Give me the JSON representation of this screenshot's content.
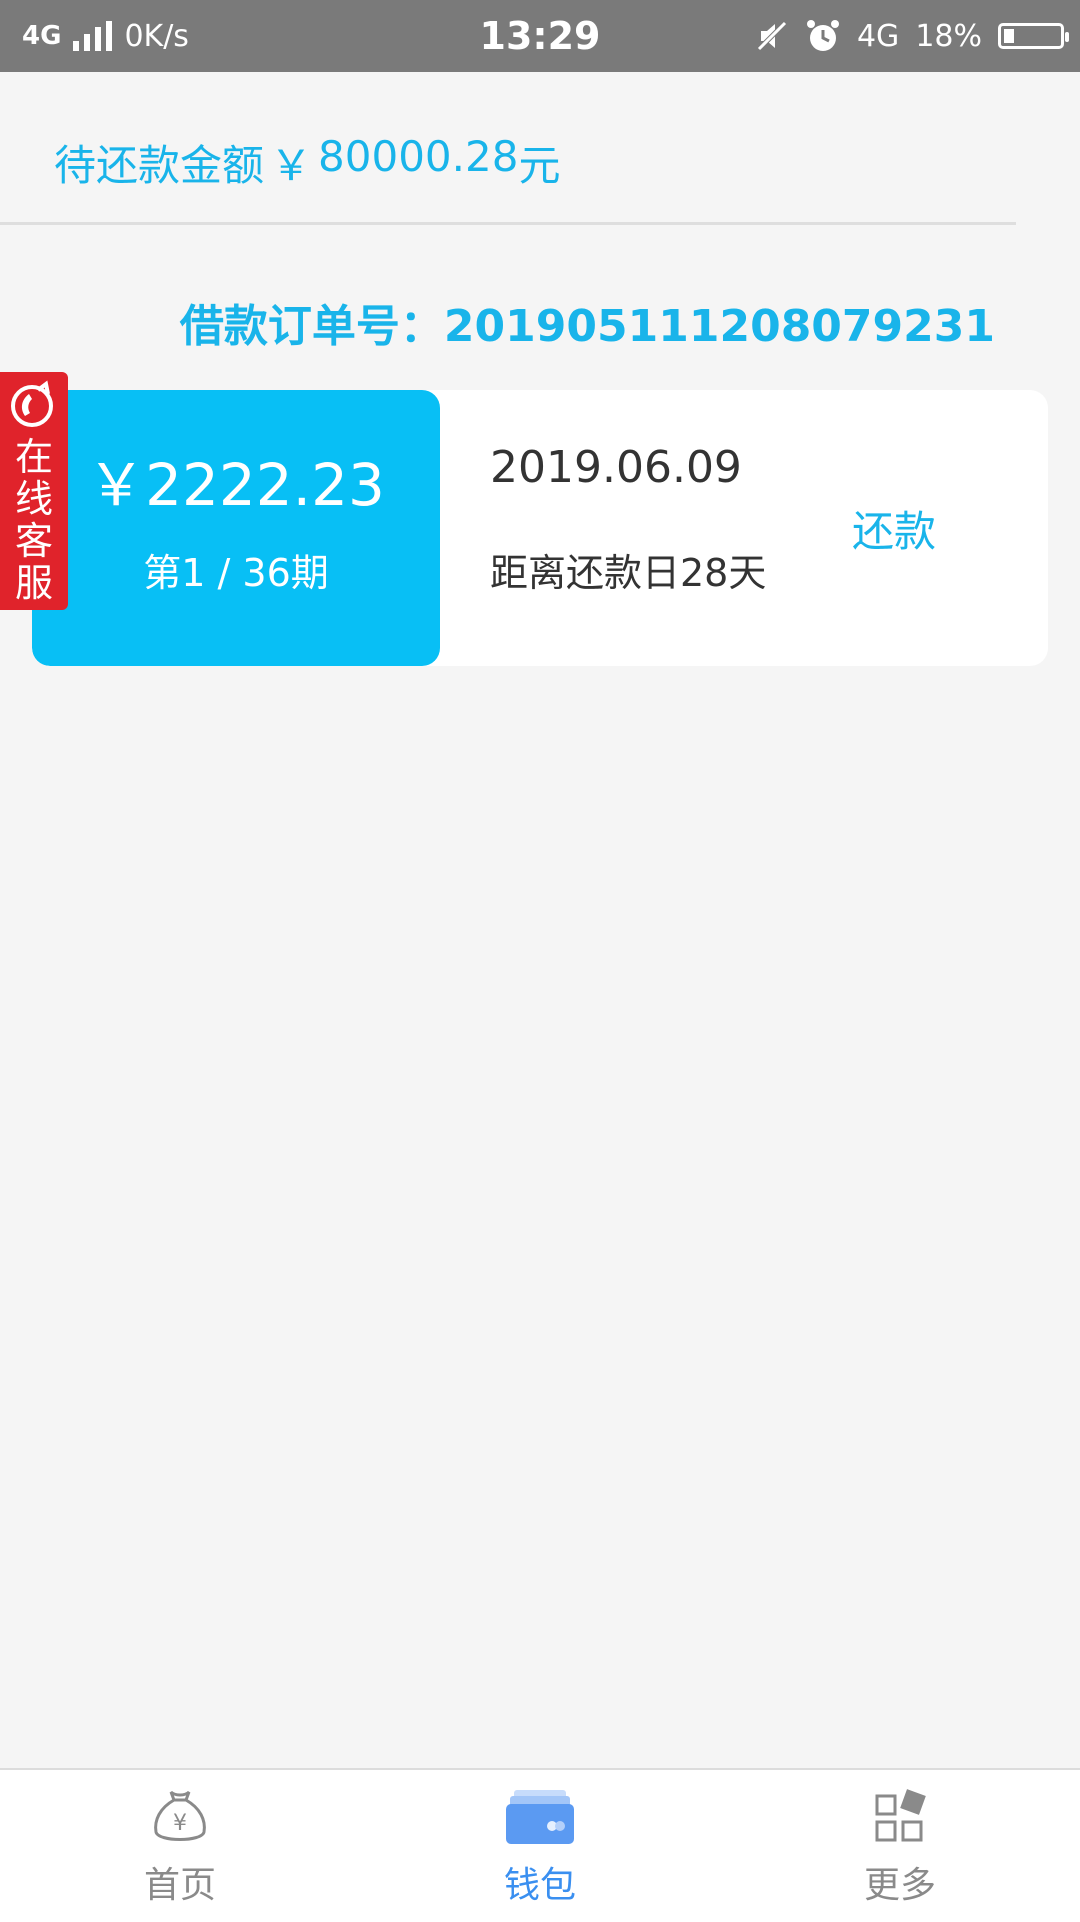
{
  "status_bar": {
    "network_left": "4G",
    "speed": "0K/s",
    "time": "13:29",
    "network_right": "4G",
    "battery": "18%",
    "battery_level": 0.18
  },
  "summary": {
    "label": "待还款金额",
    "currency": "￥",
    "amount": "80000.28",
    "unit": "元"
  },
  "order": {
    "label": "借款订单号：",
    "number": "20190511120807923 1"
  },
  "installment": {
    "amount": "￥2222.23",
    "period": "第1 / 36期",
    "due_date": "2019.06.09",
    "days_left": "距离还款日28天",
    "pay_label": "还款"
  },
  "service_tab": {
    "chars": [
      "在",
      "线",
      "客",
      "服"
    ]
  },
  "bottom_nav": {
    "items": [
      {
        "label": "首页",
        "icon": "money-bag-icon",
        "active": false
      },
      {
        "label": "钱包",
        "icon": "wallet-icon",
        "active": true
      },
      {
        "label": "更多",
        "icon": "grid-icon",
        "active": false
      }
    ]
  },
  "colors": {
    "accent": "#19b4ea",
    "card_blue": "#08bff5",
    "service_red": "#e0232b",
    "nav_active": "#3a8ff0",
    "status_bar": "#7a7a7a"
  }
}
